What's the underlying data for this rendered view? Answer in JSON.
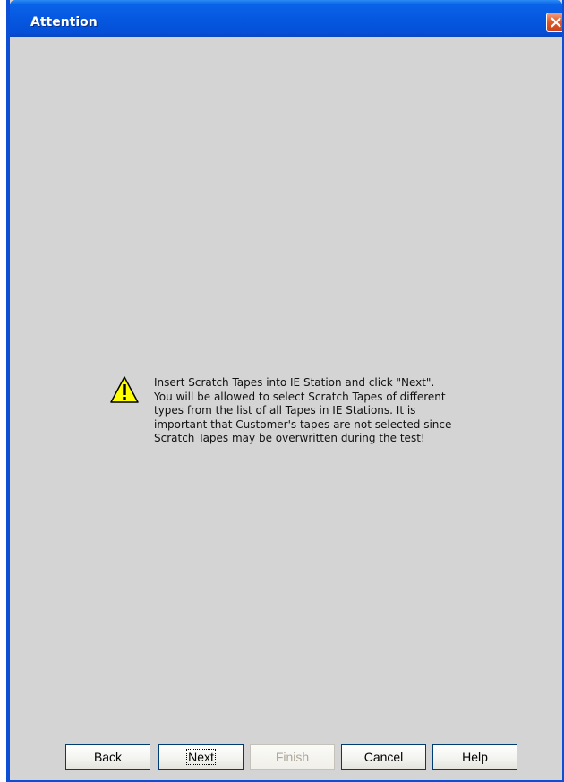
{
  "window": {
    "title": "Attention"
  },
  "message": {
    "icon": "warning-icon",
    "text": "Insert Scratch Tapes into IE Station and click \"Next\".\nYou will be allowed to select Scratch Tapes of different\ntypes from the list of all Tapes in IE Stations. It is\nimportant that Customer's tapes are not selected since\nScratch Tapes may be overwritten during the test!"
  },
  "buttons": {
    "back": "Back",
    "next": "Next",
    "finish": "Finish",
    "cancel": "Cancel",
    "help": "Help"
  },
  "colors": {
    "titlebar": "#0658e0",
    "background": "#d4d4d4",
    "close": "#e05a2a"
  }
}
